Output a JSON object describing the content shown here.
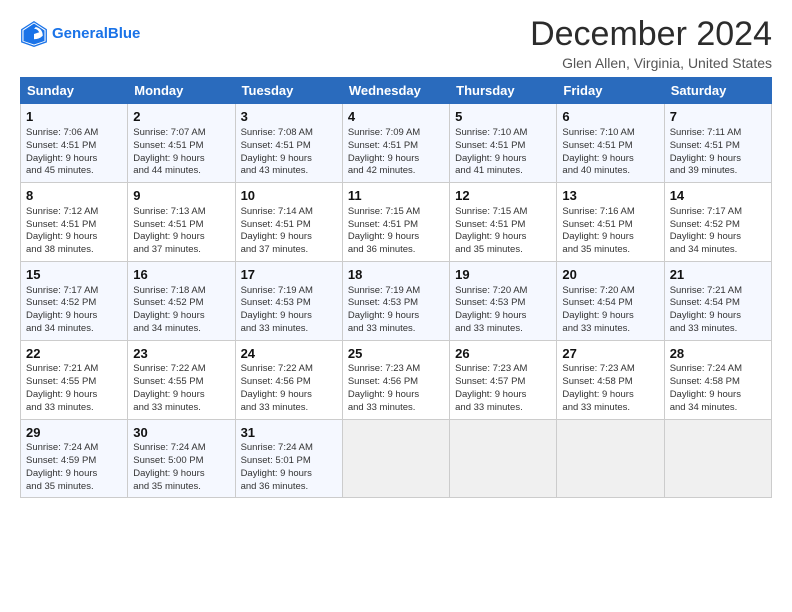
{
  "header": {
    "logo_line1": "General",
    "logo_line2": "Blue",
    "title": "December 2024",
    "location": "Glen Allen, Virginia, United States"
  },
  "days_of_week": [
    "Sunday",
    "Monday",
    "Tuesday",
    "Wednesday",
    "Thursday",
    "Friday",
    "Saturday"
  ],
  "weeks": [
    [
      {
        "day": "1",
        "lines": [
          "Sunrise: 7:06 AM",
          "Sunset: 4:51 PM",
          "Daylight: 9 hours",
          "and 45 minutes."
        ]
      },
      {
        "day": "2",
        "lines": [
          "Sunrise: 7:07 AM",
          "Sunset: 4:51 PM",
          "Daylight: 9 hours",
          "and 44 minutes."
        ]
      },
      {
        "day": "3",
        "lines": [
          "Sunrise: 7:08 AM",
          "Sunset: 4:51 PM",
          "Daylight: 9 hours",
          "and 43 minutes."
        ]
      },
      {
        "day": "4",
        "lines": [
          "Sunrise: 7:09 AM",
          "Sunset: 4:51 PM",
          "Daylight: 9 hours",
          "and 42 minutes."
        ]
      },
      {
        "day": "5",
        "lines": [
          "Sunrise: 7:10 AM",
          "Sunset: 4:51 PM",
          "Daylight: 9 hours",
          "and 41 minutes."
        ]
      },
      {
        "day": "6",
        "lines": [
          "Sunrise: 7:10 AM",
          "Sunset: 4:51 PM",
          "Daylight: 9 hours",
          "and 40 minutes."
        ]
      },
      {
        "day": "7",
        "lines": [
          "Sunrise: 7:11 AM",
          "Sunset: 4:51 PM",
          "Daylight: 9 hours",
          "and 39 minutes."
        ]
      }
    ],
    [
      {
        "day": "8",
        "lines": [
          "Sunrise: 7:12 AM",
          "Sunset: 4:51 PM",
          "Daylight: 9 hours",
          "and 38 minutes."
        ]
      },
      {
        "day": "9",
        "lines": [
          "Sunrise: 7:13 AM",
          "Sunset: 4:51 PM",
          "Daylight: 9 hours",
          "and 37 minutes."
        ]
      },
      {
        "day": "10",
        "lines": [
          "Sunrise: 7:14 AM",
          "Sunset: 4:51 PM",
          "Daylight: 9 hours",
          "and 37 minutes."
        ]
      },
      {
        "day": "11",
        "lines": [
          "Sunrise: 7:15 AM",
          "Sunset: 4:51 PM",
          "Daylight: 9 hours",
          "and 36 minutes."
        ]
      },
      {
        "day": "12",
        "lines": [
          "Sunrise: 7:15 AM",
          "Sunset: 4:51 PM",
          "Daylight: 9 hours",
          "and 35 minutes."
        ]
      },
      {
        "day": "13",
        "lines": [
          "Sunrise: 7:16 AM",
          "Sunset: 4:51 PM",
          "Daylight: 9 hours",
          "and 35 minutes."
        ]
      },
      {
        "day": "14",
        "lines": [
          "Sunrise: 7:17 AM",
          "Sunset: 4:52 PM",
          "Daylight: 9 hours",
          "and 34 minutes."
        ]
      }
    ],
    [
      {
        "day": "15",
        "lines": [
          "Sunrise: 7:17 AM",
          "Sunset: 4:52 PM",
          "Daylight: 9 hours",
          "and 34 minutes."
        ]
      },
      {
        "day": "16",
        "lines": [
          "Sunrise: 7:18 AM",
          "Sunset: 4:52 PM",
          "Daylight: 9 hours",
          "and 34 minutes."
        ]
      },
      {
        "day": "17",
        "lines": [
          "Sunrise: 7:19 AM",
          "Sunset: 4:53 PM",
          "Daylight: 9 hours",
          "and 33 minutes."
        ]
      },
      {
        "day": "18",
        "lines": [
          "Sunrise: 7:19 AM",
          "Sunset: 4:53 PM",
          "Daylight: 9 hours",
          "and 33 minutes."
        ]
      },
      {
        "day": "19",
        "lines": [
          "Sunrise: 7:20 AM",
          "Sunset: 4:53 PM",
          "Daylight: 9 hours",
          "and 33 minutes."
        ]
      },
      {
        "day": "20",
        "lines": [
          "Sunrise: 7:20 AM",
          "Sunset: 4:54 PM",
          "Daylight: 9 hours",
          "and 33 minutes."
        ]
      },
      {
        "day": "21",
        "lines": [
          "Sunrise: 7:21 AM",
          "Sunset: 4:54 PM",
          "Daylight: 9 hours",
          "and 33 minutes."
        ]
      }
    ],
    [
      {
        "day": "22",
        "lines": [
          "Sunrise: 7:21 AM",
          "Sunset: 4:55 PM",
          "Daylight: 9 hours",
          "and 33 minutes."
        ]
      },
      {
        "day": "23",
        "lines": [
          "Sunrise: 7:22 AM",
          "Sunset: 4:55 PM",
          "Daylight: 9 hours",
          "and 33 minutes."
        ]
      },
      {
        "day": "24",
        "lines": [
          "Sunrise: 7:22 AM",
          "Sunset: 4:56 PM",
          "Daylight: 9 hours",
          "and 33 minutes."
        ]
      },
      {
        "day": "25",
        "lines": [
          "Sunrise: 7:23 AM",
          "Sunset: 4:56 PM",
          "Daylight: 9 hours",
          "and 33 minutes."
        ]
      },
      {
        "day": "26",
        "lines": [
          "Sunrise: 7:23 AM",
          "Sunset: 4:57 PM",
          "Daylight: 9 hours",
          "and 33 minutes."
        ]
      },
      {
        "day": "27",
        "lines": [
          "Sunrise: 7:23 AM",
          "Sunset: 4:58 PM",
          "Daylight: 9 hours",
          "and 33 minutes."
        ]
      },
      {
        "day": "28",
        "lines": [
          "Sunrise: 7:24 AM",
          "Sunset: 4:58 PM",
          "Daylight: 9 hours",
          "and 34 minutes."
        ]
      }
    ],
    [
      {
        "day": "29",
        "lines": [
          "Sunrise: 7:24 AM",
          "Sunset: 4:59 PM",
          "Daylight: 9 hours",
          "and 35 minutes."
        ]
      },
      {
        "day": "30",
        "lines": [
          "Sunrise: 7:24 AM",
          "Sunset: 5:00 PM",
          "Daylight: 9 hours",
          "and 35 minutes."
        ]
      },
      {
        "day": "31",
        "lines": [
          "Sunrise: 7:24 AM",
          "Sunset: 5:01 PM",
          "Daylight: 9 hours",
          "and 36 minutes."
        ]
      },
      {
        "day": "",
        "lines": []
      },
      {
        "day": "",
        "lines": []
      },
      {
        "day": "",
        "lines": []
      },
      {
        "day": "",
        "lines": []
      }
    ]
  ]
}
